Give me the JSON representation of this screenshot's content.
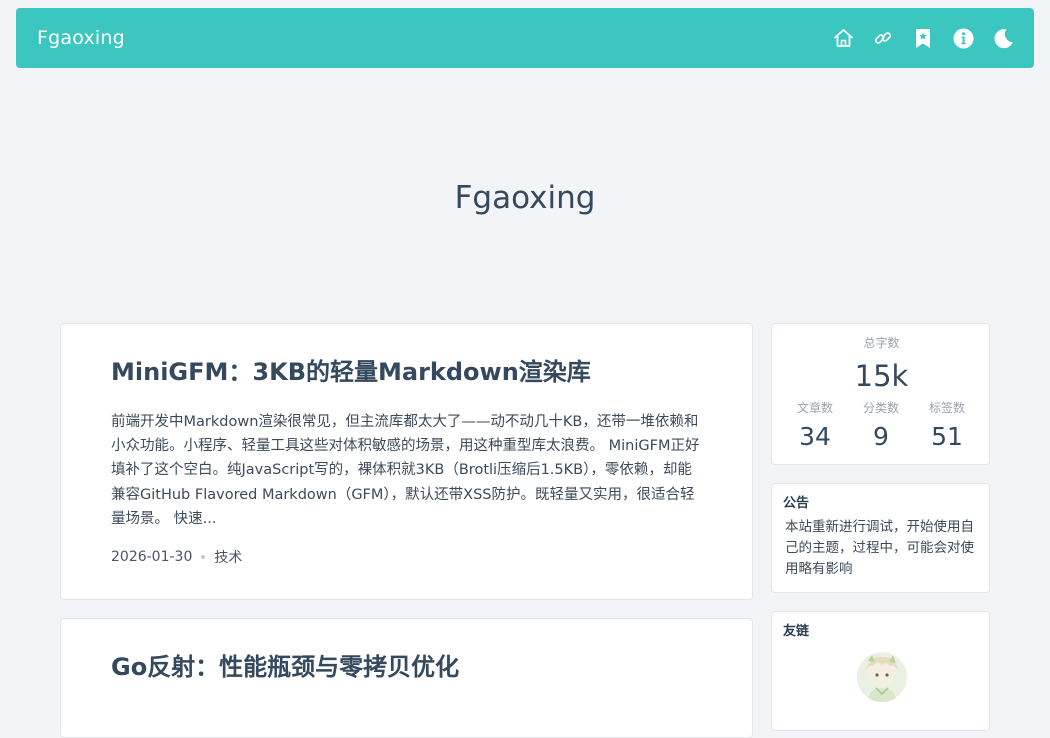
{
  "site": {
    "brand": "Fgaoxing",
    "hero_title": "Fgaoxing"
  },
  "nav": {
    "icons": [
      "home-icon",
      "link-icon",
      "bookmark-icon",
      "info-icon",
      "moon-icon"
    ]
  },
  "posts": [
    {
      "title": "MiniGFM：3KB的轻量Markdown渲染库",
      "excerpt": "前端开发中Markdown渲染很常见，但主流库都太大了——动不动几十KB，还带一堆依赖和小众功能。小程序、轻量工具这些对体积敏感的场景，用这种重型库太浪费。 MiniGFM正好填补了这个空白。纯JavaScript写的，裸体积就3KB（Brotli压缩后1.5KB），零依赖，却能兼容GitHub Flavored Markdown（GFM），默认还带XSS防护。既轻量又实用，很适合轻量场景。 快速...",
      "date": "2026-01-30",
      "category": "技术"
    },
    {
      "title": "Go反射：性能瓶颈与零拷贝优化"
    }
  ],
  "stats": {
    "total_words_label": "总字数",
    "total_words": "15k",
    "articles_label": "文章数",
    "articles": "34",
    "categories_label": "分类数",
    "categories": "9",
    "tags_label": "标签数",
    "tags": "51"
  },
  "notice": {
    "title": "公告",
    "text": "本站重新进行调试，开始使用自己的主题，过程中，可能会对使用略有影响"
  },
  "links": {
    "title": "友链"
  },
  "colors": {
    "topbar": "#3bc6bf",
    "background": "#f3f4f7",
    "text": "#34495e"
  }
}
